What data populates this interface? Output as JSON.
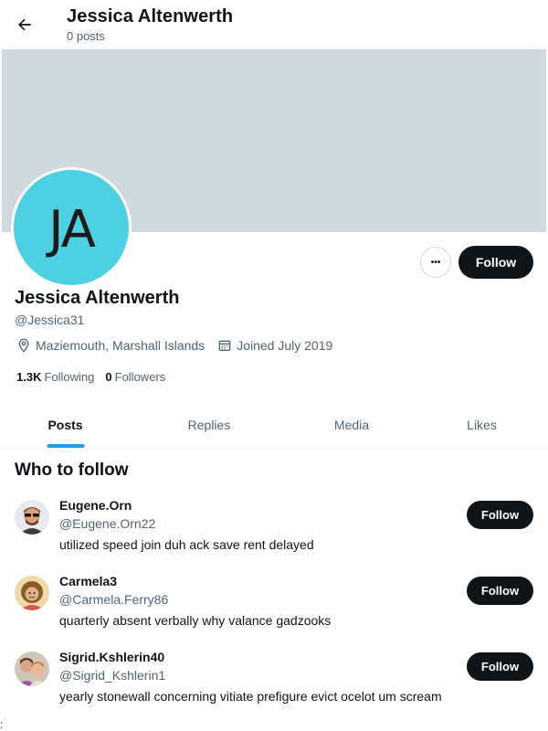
{
  "header": {
    "title": "Jessica Altenwerth",
    "posts_count": "0 posts"
  },
  "profile": {
    "initials": "JA",
    "avatar_color": "#4dd0e1",
    "banner_color": "#cfd9de",
    "name": "Jessica Altenwerth",
    "handle": "@Jessica31",
    "location": "Maziemouth, Marshall Islands",
    "joined": "Joined July 2019",
    "following_count": "1.3K",
    "following_label": "Following",
    "followers_count": "0",
    "followers_label": "Followers",
    "follow_label": "Follow",
    "more_label": "•••"
  },
  "tabs": [
    {
      "label": "Posts",
      "active": true
    },
    {
      "label": "Replies",
      "active": false
    },
    {
      "label": "Media",
      "active": false
    },
    {
      "label": "Likes",
      "active": false
    }
  ],
  "who_to_follow": {
    "title": "Who to follow",
    "follow_label": "Follow",
    "users": [
      {
        "name": "Eugene.Orn",
        "handle": "@Eugene.Orn22",
        "bio": "utilized speed join duh ack save rent delayed"
      },
      {
        "name": "Carmela3",
        "handle": "@Carmela.Ferry86",
        "bio": "quarterly absent verbally why valance gadzooks"
      },
      {
        "name": "Sigrid.Kshlerin40",
        "handle": "@Sigrid_Kshlerin1",
        "bio": "yearly stonewall concerning vitiate prefigure evict ocelot um scream"
      }
    ]
  },
  "accent_color": "#1d9bf0",
  "footer_char": ":"
}
